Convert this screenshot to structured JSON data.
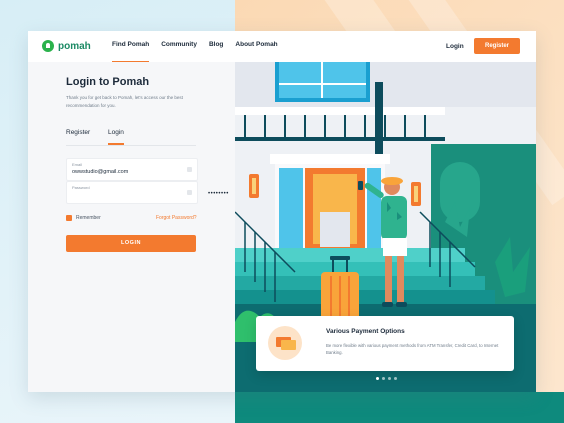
{
  "brand": {
    "name": "pomah"
  },
  "nav": {
    "links": [
      "Find Pomah",
      "Community",
      "Blog",
      "About Pomah"
    ],
    "login_label": "Login",
    "register_label": "Register"
  },
  "login_form": {
    "title": "Login to Pomah",
    "subtitle": "Thank you for get back to Pomah, let's access our the best recommendation for you.",
    "tabs": [
      "Register",
      "Login"
    ],
    "email": {
      "label": "Email",
      "value": "owwstudio@gmail.com"
    },
    "password": {
      "label": "Password",
      "value": "••••••••"
    },
    "remember_label": "Remember",
    "remember_checked": true,
    "forgot_label": "Forgot Password?",
    "submit_label": "LOGIN"
  },
  "testimonial": {
    "title": "Various Payment Options",
    "description": "Be more flexible with various payment methods from ATM Transfer, Credit Card, to Internet Banking."
  },
  "carousel": {
    "count": 4,
    "active": 0
  },
  "colors": {
    "accent": "#f37a2f",
    "brand": "#2bb24c",
    "teal": "#0e8a7d"
  }
}
